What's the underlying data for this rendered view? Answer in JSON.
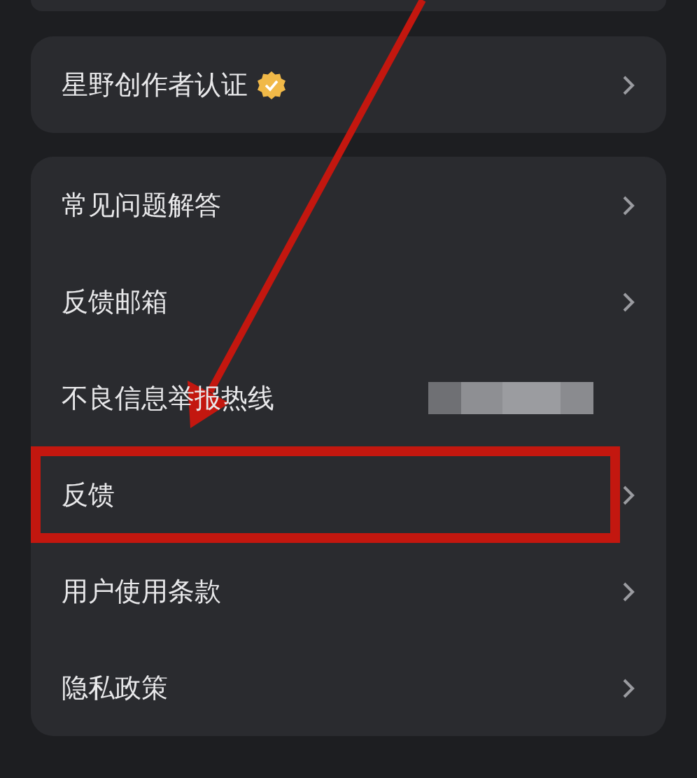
{
  "sections": [
    {
      "items": [
        {
          "label": "星野创作者认证",
          "kind": "link",
          "verified": true,
          "highlighted": false
        }
      ]
    },
    {
      "items": [
        {
          "label": "常见问题解答",
          "kind": "link",
          "verified": false,
          "highlighted": false
        },
        {
          "label": "反馈邮箱",
          "kind": "link",
          "verified": false,
          "highlighted": false
        },
        {
          "label": "不良信息举报热线",
          "kind": "redacted",
          "verified": false,
          "highlighted": false
        },
        {
          "label": "反馈",
          "kind": "link",
          "verified": false,
          "highlighted": true
        },
        {
          "label": "用户使用条款",
          "kind": "link",
          "verified": false,
          "highlighted": false
        },
        {
          "label": "隐私政策",
          "kind": "link",
          "verified": false,
          "highlighted": false
        }
      ]
    }
  ]
}
